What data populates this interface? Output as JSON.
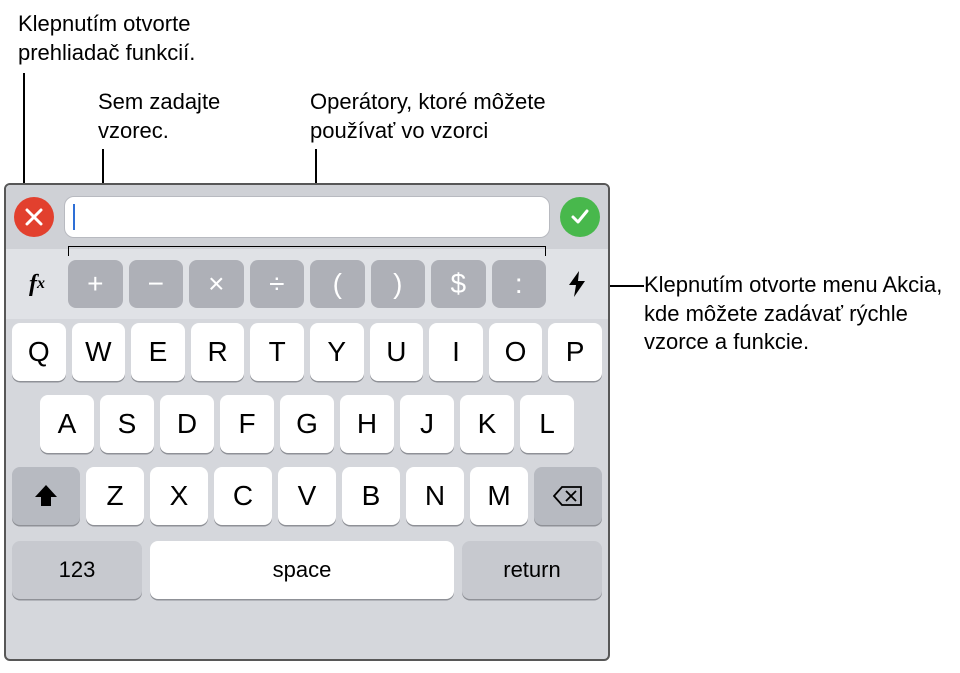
{
  "callouts": {
    "fx": "Klepnutím otvorte prehliadač funkcií.",
    "formula": "Sem zadajte vzorec.",
    "operators": "Operátory, ktoré môžete používať vo vzorci",
    "action": "Klepnutím otvorte menu Akcia, kde môžete zadávať rýchle vzorce a funkcie."
  },
  "formula_bar": {
    "value": ""
  },
  "fx_label_main": "f",
  "fx_label_sub": "x",
  "operators": [
    "+",
    "−",
    "×",
    "÷",
    "(",
    ")",
    "$",
    ":"
  ],
  "row1": [
    "Q",
    "W",
    "E",
    "R",
    "T",
    "Y",
    "U",
    "I",
    "O",
    "P"
  ],
  "row2": [
    "A",
    "S",
    "D",
    "F",
    "G",
    "H",
    "J",
    "K",
    "L"
  ],
  "row3": [
    "Z",
    "X",
    "C",
    "V",
    "B",
    "N",
    "M"
  ],
  "bottom": {
    "numbers": "123",
    "space": "space",
    "ret": "return"
  }
}
